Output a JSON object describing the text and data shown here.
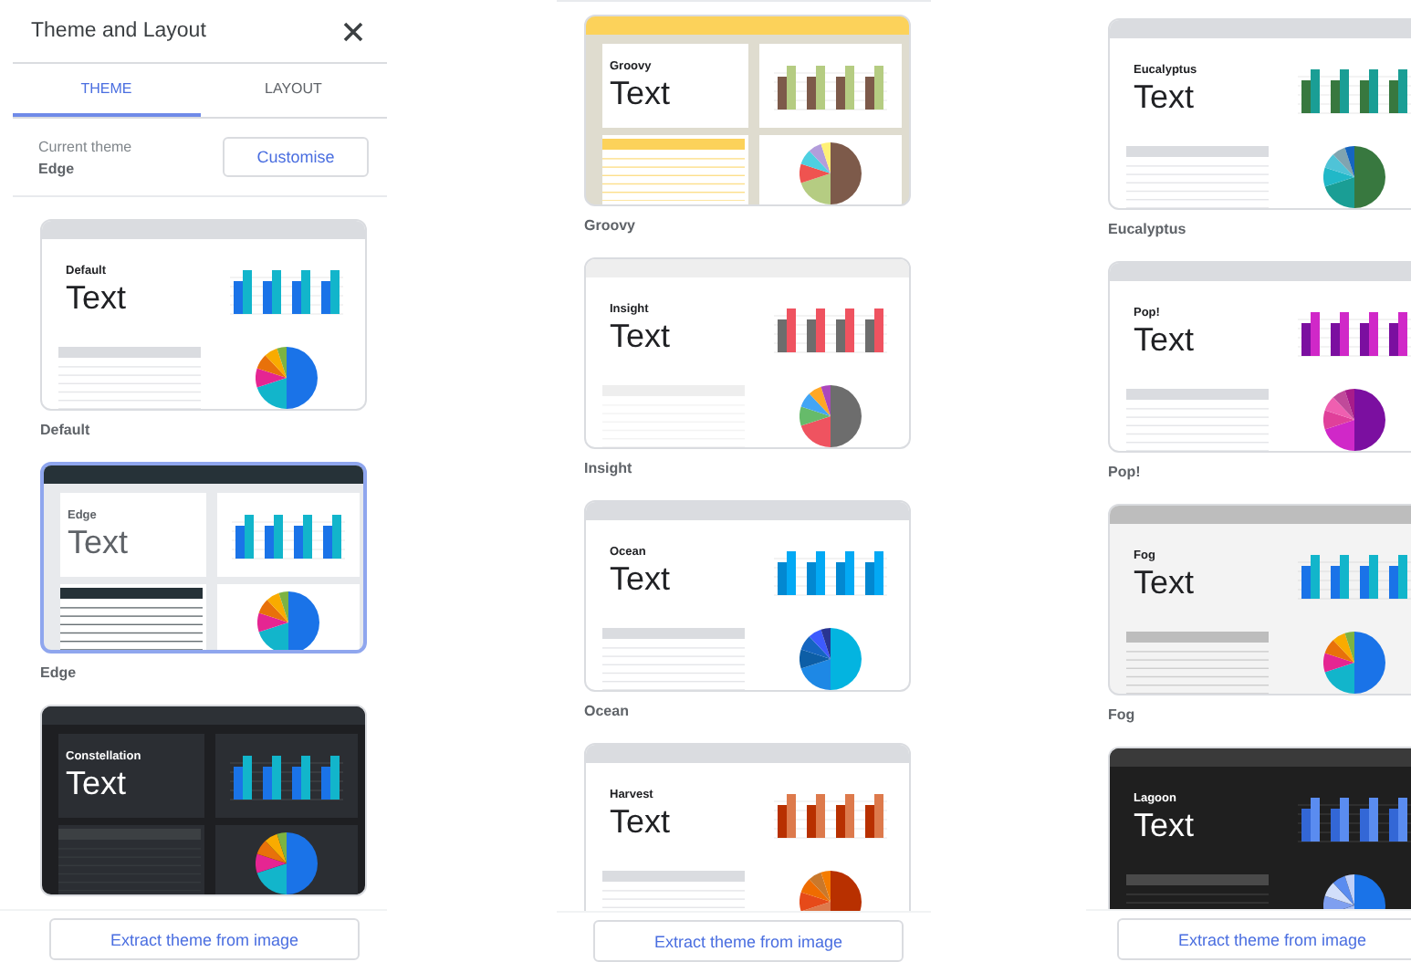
{
  "panels": [
    {
      "header": {
        "title": "Theme and Layout"
      },
      "tabs": [
        {
          "label": "THEME",
          "selected": true
        },
        {
          "label": "LAYOUT",
          "selected": false
        }
      ],
      "current_theme": {
        "label": "Current theme",
        "value": "Edge",
        "button": "Customise"
      },
      "themes": [
        {
          "title": "Default",
          "sample": "Text",
          "caption": "Default",
          "selected": false,
          "kind": "plain",
          "header": {
            "color": "#dadce0"
          },
          "ground": {
            "color": "#ffffff"
          },
          "ink": {
            "color": "#202124"
          },
          "rule": {
            "color": "#dadce0"
          },
          "bars": [
            {
              "color": "#1a73e8"
            },
            {
              "color": "#12b5cb"
            }
          ],
          "pie": [
            {
              "color": "#1a73e8"
            },
            {
              "color": "#12b5cb"
            },
            {
              "color": "#e52592"
            },
            {
              "color": "#e8710a"
            },
            {
              "color": "#f9ab00"
            },
            {
              "color": "#7cb342"
            }
          ]
        },
        {
          "title": "Edge",
          "sample": "Text",
          "caption": "Edge",
          "selected": true,
          "kind": "boxed",
          "header": {
            "color": "#263238"
          },
          "ground": {
            "color": "#e8eaed"
          },
          "panel": {
            "color": "#ffffff"
          },
          "ink": {
            "color": "#5f6368"
          },
          "rule": {
            "color": "#263238"
          },
          "bars": [
            {
              "color": "#1a73e8"
            },
            {
              "color": "#12b5cb"
            }
          ],
          "pie": [
            {
              "color": "#1a73e8"
            },
            {
              "color": "#12b5cb"
            },
            {
              "color": "#e52592"
            },
            {
              "color": "#e8710a"
            },
            {
              "color": "#f9ab00"
            },
            {
              "color": "#7cb342"
            }
          ]
        },
        {
          "title": "Constellation",
          "sample": "Text",
          "selected": false,
          "kind": "boxed",
          "header": {
            "color": "#2d3136"
          },
          "ground": {
            "color": "#1e1f22"
          },
          "panel": {
            "color": "#2b2e33"
          },
          "ink": {
            "color": "#ffffff"
          },
          "rule": {
            "color": "#3c4043"
          },
          "bars": [
            {
              "color": "#1a73e8"
            },
            {
              "color": "#12b5cb"
            }
          ],
          "pie": [
            {
              "color": "#1a73e8"
            },
            {
              "color": "#12b5cb"
            },
            {
              "color": "#e52592"
            },
            {
              "color": "#e8710a"
            },
            {
              "color": "#f9ab00"
            },
            {
              "color": "#7cb342"
            }
          ]
        }
      ],
      "extract_button": "Extract theme from image"
    },
    {
      "themes": [
        {
          "title": "Groovy",
          "sample": "Text",
          "caption": "Groovy",
          "selected": false,
          "kind": "boxed",
          "header": {
            "color": "#fcd25a"
          },
          "ground": {
            "color": "#dfdccf"
          },
          "panel": {
            "color": "#ffffff"
          },
          "ink": {
            "color": "#202124"
          },
          "rule": {
            "color": "#fcd25a"
          },
          "bars": [
            {
              "color": "#7d5a4a"
            },
            {
              "color": "#b5cc82"
            }
          ],
          "pie": [
            {
              "color": "#7d5a4a"
            },
            {
              "color": "#b5cc82"
            },
            {
              "color": "#ef5350"
            },
            {
              "color": "#4dd0e1"
            },
            {
              "color": "#b39ddb"
            },
            {
              "color": "#fff176"
            }
          ]
        },
        {
          "title": "Insight",
          "sample": "Text",
          "caption": "Insight",
          "selected": false,
          "kind": "plain",
          "header": {
            "color": "#eeeeee"
          },
          "ground": {
            "color": "#ffffff"
          },
          "ink": {
            "color": "#202124"
          },
          "rule": {
            "color": "#eeeeee"
          },
          "bars": [
            {
              "color": "#6d6d6d"
            },
            {
              "color": "#ef5360"
            }
          ],
          "pie": [
            {
              "color": "#6d6d6d"
            },
            {
              "color": "#ef5360"
            },
            {
              "color": "#66bb6a"
            },
            {
              "color": "#42a5f5"
            },
            {
              "color": "#ffa726"
            },
            {
              "color": "#ab47bc"
            }
          ]
        },
        {
          "title": "Ocean",
          "sample": "Text",
          "caption": "Ocean",
          "selected": false,
          "kind": "plain",
          "header": {
            "color": "#dadce0"
          },
          "ground": {
            "color": "#ffffff"
          },
          "ink": {
            "color": "#202124"
          },
          "rule": {
            "color": "#dadce0"
          },
          "bars": [
            {
              "color": "#0288d1"
            },
            {
              "color": "#03a9f4"
            }
          ],
          "pie": [
            {
              "color": "#03b4e0"
            },
            {
              "color": "#1e88e5"
            },
            {
              "color": "#0d5ea6"
            },
            {
              "color": "#1565c0"
            },
            {
              "color": "#3d5afe"
            },
            {
              "color": "#283593"
            }
          ]
        },
        {
          "title": "Harvest",
          "sample": "Text",
          "selected": false,
          "kind": "plain",
          "header": {
            "color": "#dadce0"
          },
          "ground": {
            "color": "#ffffff"
          },
          "ink": {
            "color": "#202124"
          },
          "rule": {
            "color": "#dadce0"
          },
          "bars": [
            {
              "color": "#b83000"
            },
            {
              "color": "#dd7a4c"
            }
          ],
          "pie": [
            {
              "color": "#b83000"
            },
            {
              "color": "#dd7a4c"
            },
            {
              "color": "#e64a19"
            },
            {
              "color": "#ef6c00"
            },
            {
              "color": "#c9782b"
            },
            {
              "color": "#f57c00"
            }
          ]
        }
      ],
      "extract_button": "Extract theme from image"
    },
    {
      "themes": [
        {
          "title": "Eucalyptus",
          "sample": "Text",
          "caption": "Eucalyptus",
          "selected": false,
          "kind": "plain",
          "header": {
            "color": "#dadce0"
          },
          "ground": {
            "color": "#ffffff"
          },
          "ink": {
            "color": "#202124"
          },
          "rule": {
            "color": "#dadce0"
          },
          "bars": [
            {
              "color": "#38783f"
            },
            {
              "color": "#1a9e95"
            }
          ],
          "pie": [
            {
              "color": "#38783f"
            },
            {
              "color": "#1a9e95"
            },
            {
              "color": "#21b8c8"
            },
            {
              "color": "#4fc3d7"
            },
            {
              "color": "#80a4b0"
            },
            {
              "color": "#1565c0"
            }
          ]
        },
        {
          "title": "Pop!",
          "sample": "Text",
          "caption": "Pop!",
          "selected": false,
          "kind": "plain",
          "header": {
            "color": "#dadce0"
          },
          "ground": {
            "color": "#ffffff"
          },
          "ink": {
            "color": "#202124"
          },
          "rule": {
            "color": "#dadce0"
          },
          "bars": [
            {
              "color": "#7b0fa0"
            },
            {
              "color": "#d028c8"
            }
          ],
          "pie": [
            {
              "color": "#7b0fa0"
            },
            {
              "color": "#d028c8"
            },
            {
              "color": "#e0409a"
            },
            {
              "color": "#ef5fb0"
            },
            {
              "color": "#c04a9a"
            },
            {
              "color": "#a81c8a"
            }
          ]
        },
        {
          "title": "Fog",
          "sample": "Text",
          "caption": "Fog",
          "selected": false,
          "kind": "plain",
          "header": {
            "color": "#bdbdbd"
          },
          "ground": {
            "color": "#f3f3f3"
          },
          "ink": {
            "color": "#202124"
          },
          "rule": {
            "color": "#bdbdbd"
          },
          "bars": [
            {
              "color": "#1a73e8"
            },
            {
              "color": "#12b5cb"
            }
          ],
          "pie": [
            {
              "color": "#1a73e8"
            },
            {
              "color": "#12b5cb"
            },
            {
              "color": "#e52592"
            },
            {
              "color": "#e8710a"
            },
            {
              "color": "#f9ab00"
            },
            {
              "color": "#7cb342"
            }
          ]
        },
        {
          "title": "Lagoon",
          "sample": "Text",
          "selected": false,
          "kind": "plain",
          "header": {
            "color": "#3a3a3a"
          },
          "ground": {
            "color": "#1f1f1f"
          },
          "ink": {
            "color": "#ffffff"
          },
          "rule": {
            "color": "#4a4a4a"
          },
          "bars": [
            {
              "color": "#3367d6"
            },
            {
              "color": "#5a8cf0"
            }
          ],
          "pie": [
            {
              "color": "#1a73e8"
            },
            {
              "color": "#a9c1f5"
            },
            {
              "color": "#7f9ff0"
            },
            {
              "color": "#d2dffa"
            },
            {
              "color": "#5a8cf0"
            },
            {
              "color": "#c0d0f8"
            }
          ]
        }
      ],
      "extract_button": "Extract theme from image"
    }
  ]
}
